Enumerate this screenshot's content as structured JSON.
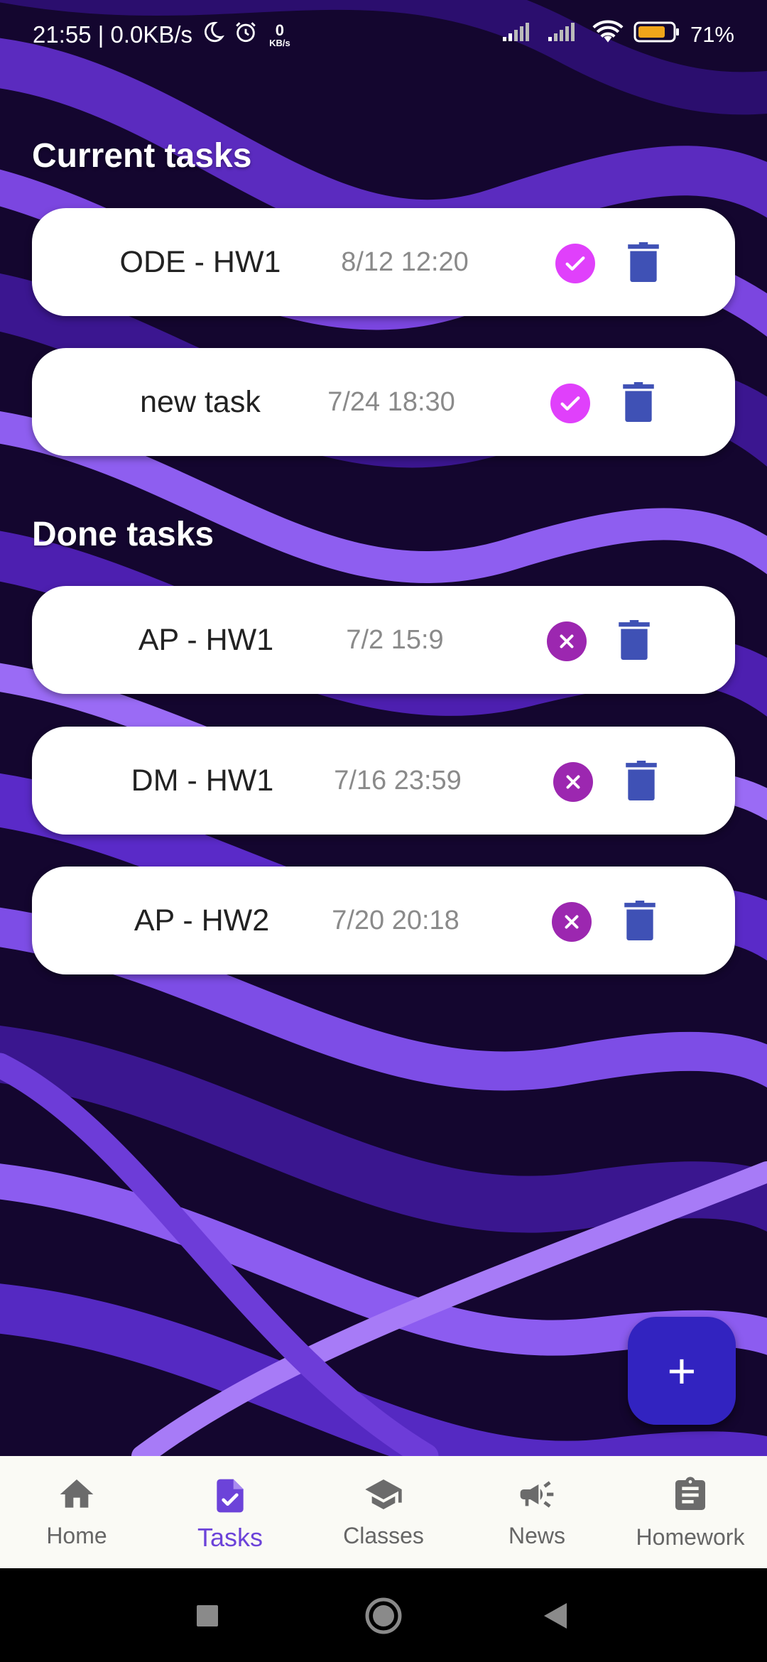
{
  "status_bar": {
    "time_speed": "21:55 | 0.0KB/s",
    "net_value": "0",
    "net_unit": "KB/s",
    "battery": "71%"
  },
  "sections": {
    "current": "Current tasks",
    "done": "Done tasks"
  },
  "current_tasks": [
    {
      "title": "ODE - HW1",
      "date": "8/12 12:20"
    },
    {
      "title": "new task",
      "date": "7/24 18:30"
    }
  ],
  "done_tasks": [
    {
      "title": "AP - HW1",
      "date": "7/2 15:9"
    },
    {
      "title": "DM - HW1",
      "date": "7/16 23:59"
    },
    {
      "title": "AP - HW2",
      "date": "7/20 20:18"
    }
  ],
  "fab": {
    "label": "+"
  },
  "bottom_nav": {
    "items": [
      {
        "label": "Home",
        "icon": "home-icon"
      },
      {
        "label": "Tasks",
        "icon": "task-icon"
      },
      {
        "label": "Classes",
        "icon": "school-icon"
      },
      {
        "label": "News",
        "icon": "campaign-icon"
      },
      {
        "label": "Homework",
        "icon": "assignment-icon"
      }
    ],
    "active": "Tasks"
  },
  "colors": {
    "accent": "#6c43d9",
    "check": "#e040fb",
    "undo": "#9c27b0",
    "trash": "#3f51b5",
    "fab": "#3223c0"
  }
}
